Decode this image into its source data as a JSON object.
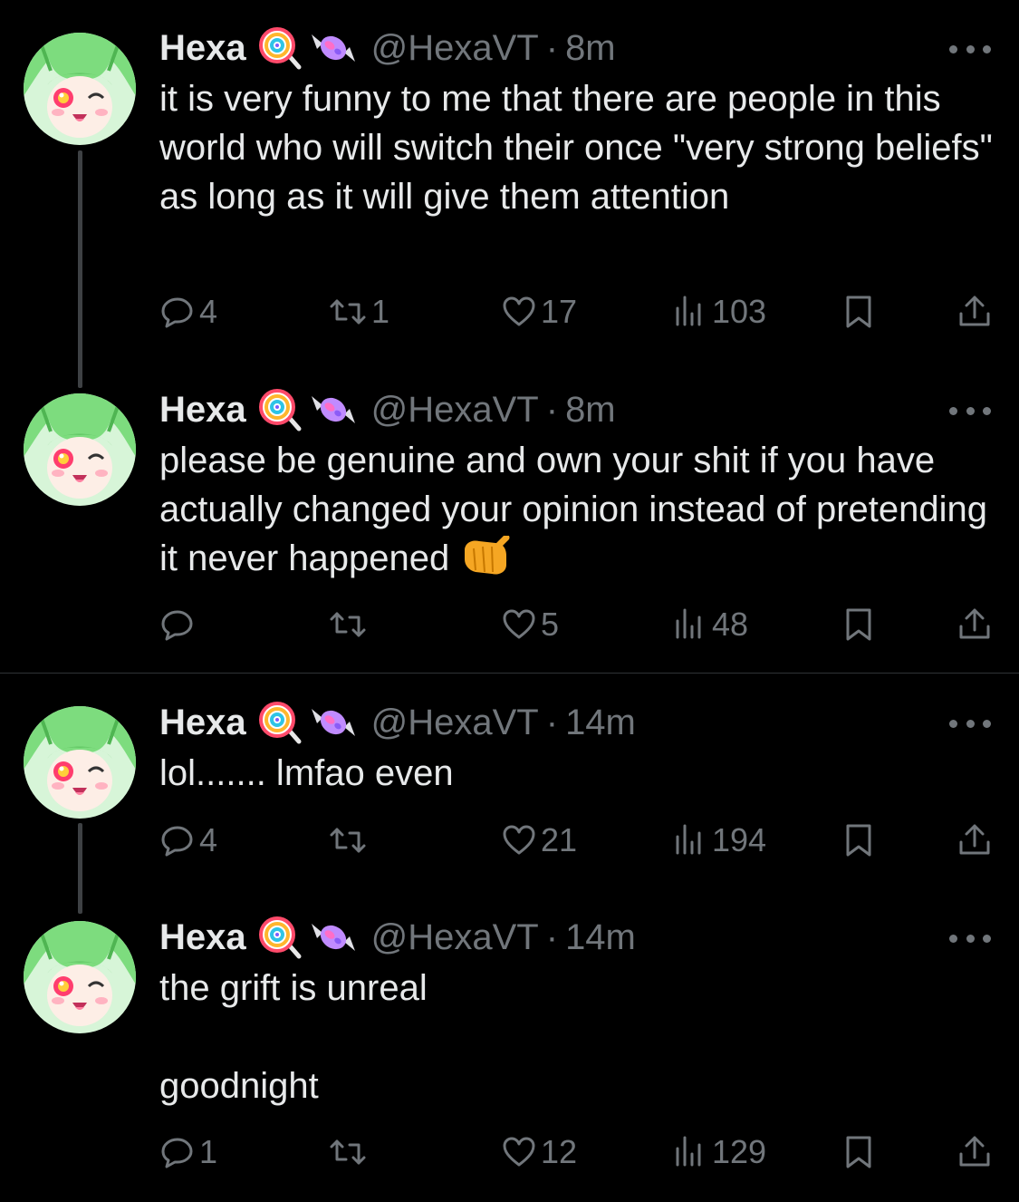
{
  "tweets": [
    {
      "name": "Hexa",
      "handle": "@HexaVT",
      "dot": "·",
      "time": "8m",
      "text": "it is very funny to me that there are people in this world who will switch their once \"very strong beliefs\" as long as it will give them attention",
      "replies": "4",
      "retweets": "1",
      "likes": "17",
      "views": "103"
    },
    {
      "name": "Hexa",
      "handle": "@HexaVT",
      "dot": "·",
      "time": "8m",
      "text": "please be genuine and own your shit if you have actually changed your opinion instead of pretending it never happened",
      "replies": "",
      "retweets": "",
      "likes": "5",
      "views": "48"
    },
    {
      "name": "Hexa",
      "handle": "@HexaVT",
      "dot": "·",
      "time": "14m",
      "text": "lol....... lmfao even",
      "replies": "4",
      "retweets": "",
      "likes": "21",
      "views": "194"
    },
    {
      "name": "Hexa",
      "handle": "@HexaVT",
      "dot": "·",
      "time": "14m",
      "text": "the grift is unreal\n\ngoodnight",
      "replies": "1",
      "retweets": "",
      "likes": "12",
      "views": "129"
    }
  ],
  "icons": {
    "name_emojis": [
      "lollipop-emoji-icon",
      "candy-emoji-icon"
    ],
    "tweet2_trailing_emoji": "pointing-fist-emoji-icon",
    "reply": "reply-icon",
    "retweet": "retweet-icon",
    "like": "heart-icon",
    "views": "views-bar-chart-icon",
    "bookmark": "bookmark-icon",
    "share": "share-icon",
    "more": "more-options-icon"
  },
  "colors": {
    "background": "#000000",
    "text": "#e7e9ea",
    "secondary": "#71767b",
    "thread_line": "#3e4144",
    "avatar_hair": "#7ddc7e"
  }
}
